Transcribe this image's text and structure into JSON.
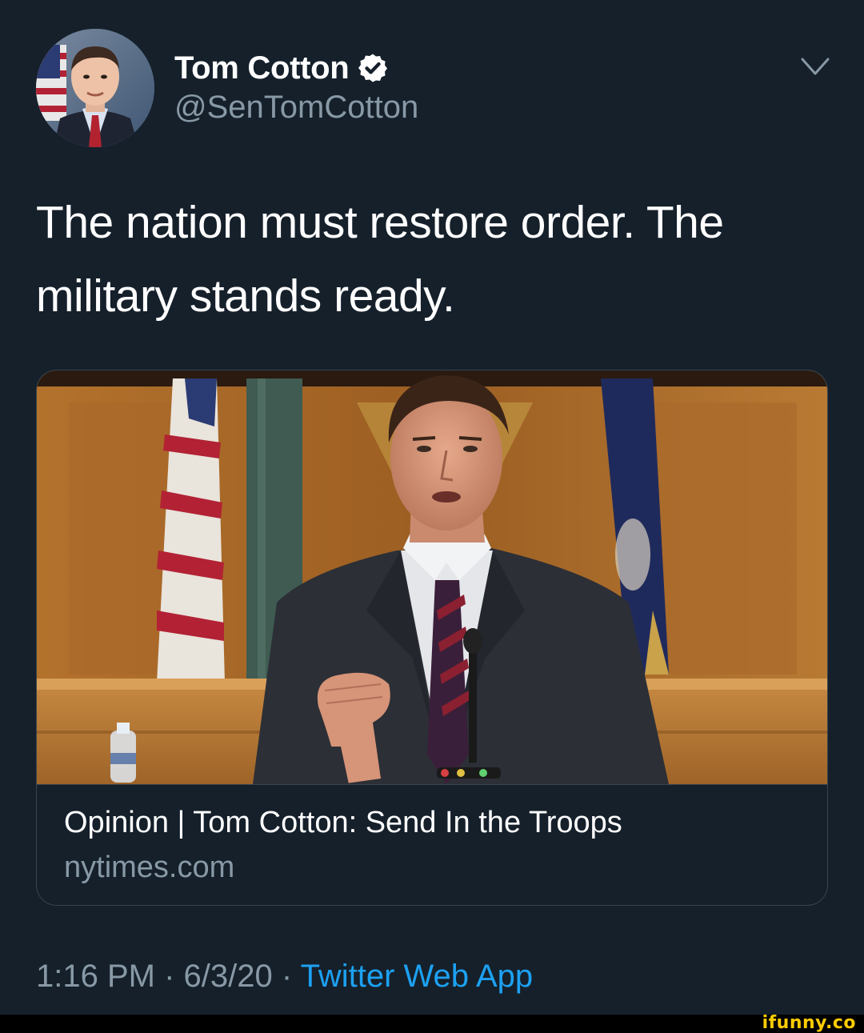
{
  "tweet": {
    "display_name": "Tom Cotton",
    "verified_icon": "verified-badge-icon",
    "handle": "@SenTomCotton",
    "menu_icon": "chevron-down-icon",
    "text": "The nation must restore order. The\nmilitary stands ready.",
    "card": {
      "title": "Opinion | Tom Cotton: Send In the Troops",
      "domain": "nytimes.com"
    },
    "time": "1:16 PM",
    "separator": "·",
    "date": "6/3/20",
    "source": "Twitter Web App"
  },
  "watermark": {
    "text": "ifunny.co"
  },
  "colors": {
    "background": "#15202b",
    "secondary_text": "#8899a6",
    "link": "#1da1f2",
    "border": "#38444d",
    "watermark": "#ffcc00"
  }
}
